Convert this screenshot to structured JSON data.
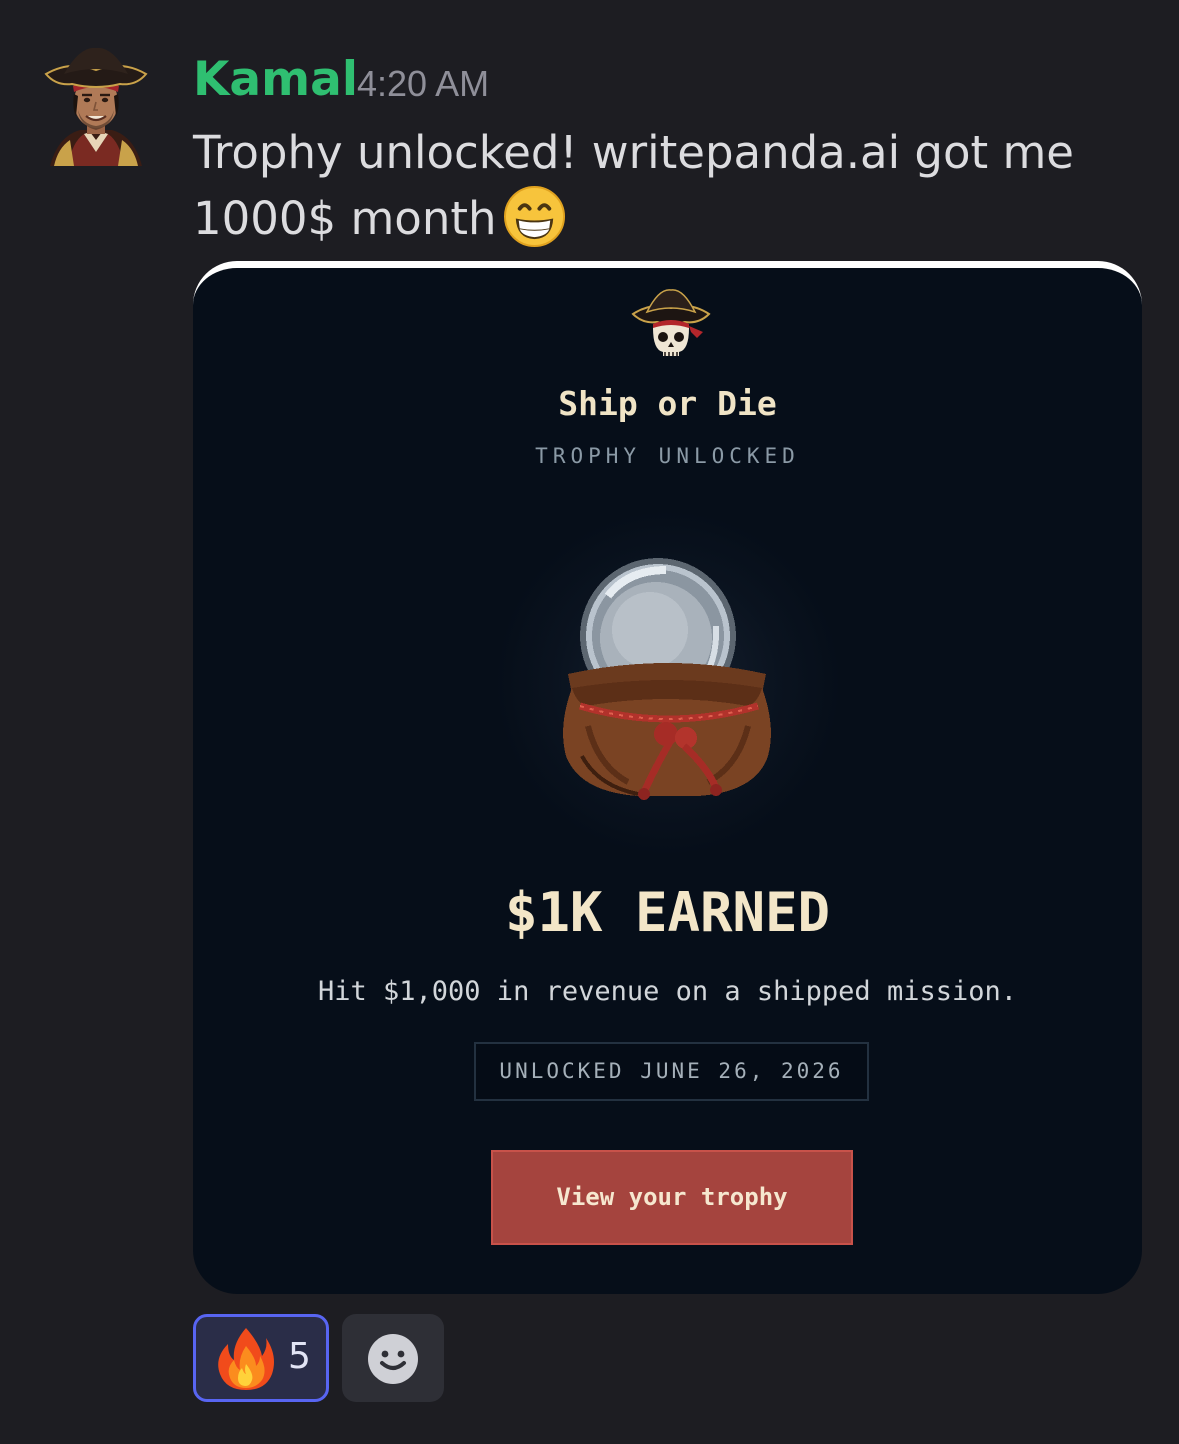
{
  "message": {
    "author": "Kamal",
    "timestamp": "4:20 AM",
    "text_line1": "Trophy unlocked! writepanda.ai got me",
    "text_line2": "1000$ month",
    "emoji": "grinning-face-emoji",
    "avatar": "pirate-avatar"
  },
  "embed": {
    "badge_icon": "pirate-skull-icon",
    "title": "Ship or Die",
    "subtitle": "TROPHY UNLOCKED",
    "trophy_art": "coin-pouch-icon",
    "trophy_name": "$1K EARNED",
    "description": "Hit $1,000 in revenue on a shipped mission.",
    "unlock_date": "UNLOCKED JUNE 26, 2026",
    "button_label": "View your trophy",
    "colors": {
      "background": "#060e19",
      "accent_button": "#a5443e",
      "title_text": "#f0e4c6"
    }
  },
  "reactions": [
    {
      "emoji": "fire-icon",
      "count": "5",
      "selected": true
    }
  ],
  "add_reaction_icon": "smiley-icon",
  "colors": {
    "app_background": "#1d1d22",
    "author_name": "#2fbf71",
    "selected_reaction_border": "#5865f2"
  }
}
